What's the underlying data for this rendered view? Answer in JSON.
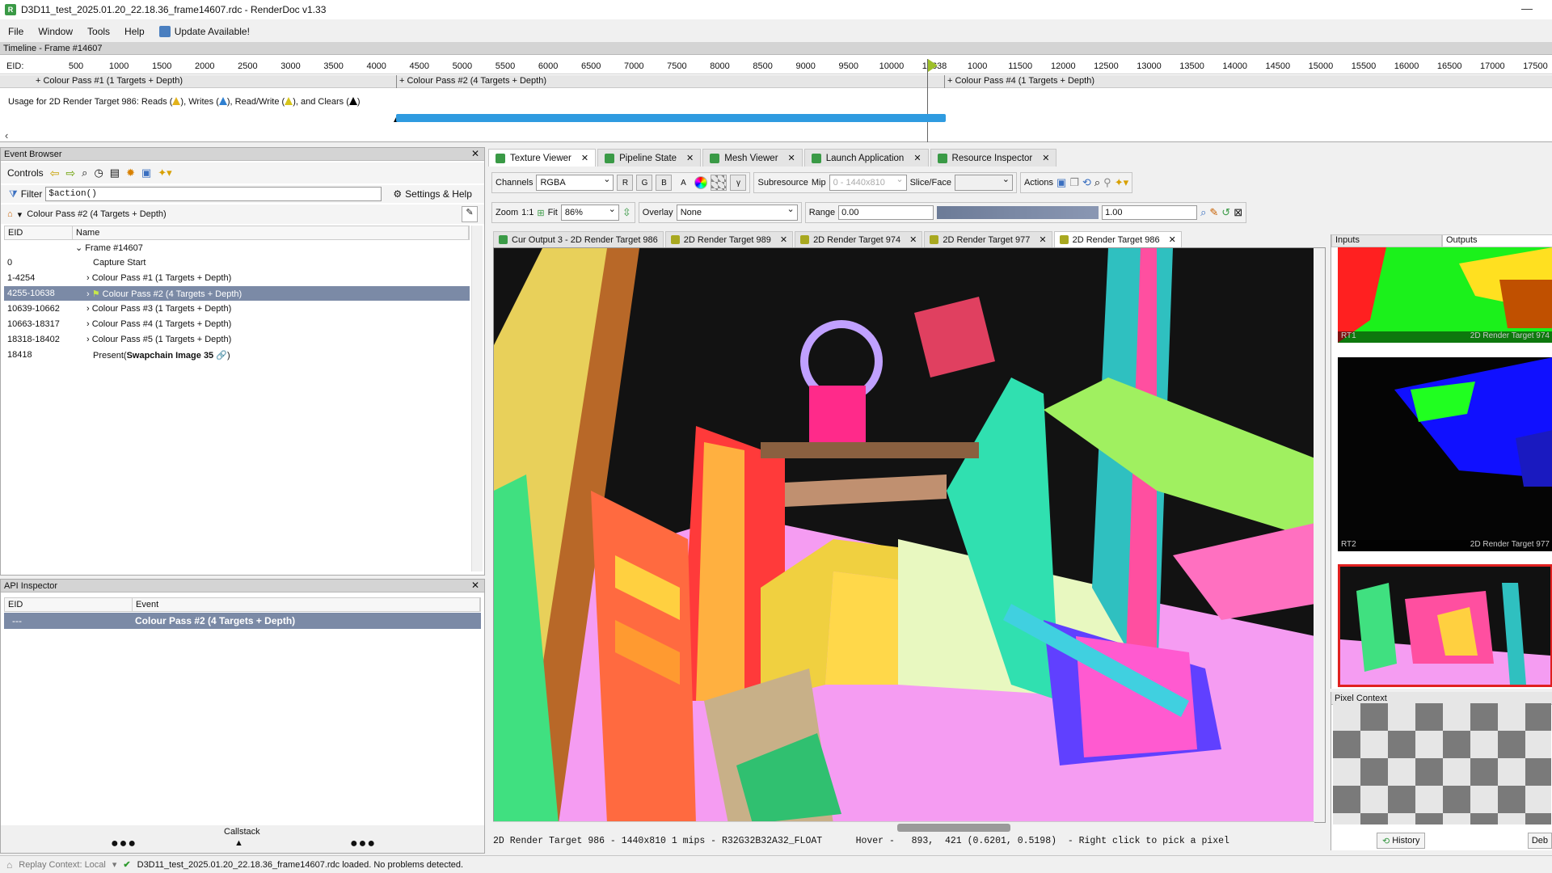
{
  "window": {
    "title": "D3D11_test_2025.01.20_22.18.36_frame14607.rdc - RenderDoc v1.33"
  },
  "menu": {
    "file": "File",
    "window": "Window",
    "tools": "Tools",
    "help": "Help",
    "update": "Update Available!"
  },
  "timeline": {
    "title": "Timeline - Frame #14607",
    "eid_label": "EID:",
    "ticks": [
      "500",
      "1000",
      "1500",
      "2000",
      "2500",
      "3000",
      "3500",
      "4000",
      "4500",
      "5000",
      "5500",
      "6000",
      "6500",
      "7000",
      "7500",
      "8000",
      "8500",
      "9000",
      "9500",
      "10000",
      "10638",
      "1000",
      "11500",
      "12000",
      "12500",
      "13000",
      "13500",
      "14000",
      "14500",
      "15000",
      "15500",
      "16000",
      "16500",
      "17000",
      "17500"
    ],
    "passes": [
      "+ Colour Pass #1 (1 Targets + Depth)",
      "+ Colour Pass #2 (4 Targets + Depth)",
      "+ Colour Pass #4 (1 Targets + Depth)"
    ],
    "usage_prefix": "Usage for 2D Render Target 986: Reads (",
    "usage_writes": "), Writes (",
    "usage_rw": "), Read/Write (",
    "usage_clears": "), and Clears (",
    "usage_end": ")"
  },
  "event_browser": {
    "title": "Event Browser",
    "controls_label": "Controls",
    "filter_label": "Filter",
    "filter_value": "$action()",
    "settings_label": "Settings & Help",
    "breadcrumb": "Colour Pass #2 (4 Targets + Depth)",
    "col_eid": "EID",
    "col_name": "Name",
    "rows": [
      {
        "eid": "",
        "name": "Frame #14607"
      },
      {
        "eid": "0",
        "name": "Capture Start"
      },
      {
        "eid": "1-4254",
        "name": "Colour Pass #1 (1 Targets + Depth)"
      },
      {
        "eid": "4255-10638",
        "name": "Colour Pass #2 (4 Targets + Depth)"
      },
      {
        "eid": "10639-10662",
        "name": "Colour Pass #3 (1 Targets + Depth)"
      },
      {
        "eid": "10663-18317",
        "name": "Colour Pass #4 (1 Targets + Depth)"
      },
      {
        "eid": "18318-18402",
        "name": "Colour Pass #5 (1 Targets + Depth)"
      },
      {
        "eid": "18418",
        "name": "Present(",
        "bold": "Swapchain Image 35",
        "tail": ")"
      }
    ]
  },
  "api_inspector": {
    "title": "API Inspector",
    "col_eid": "EID",
    "col_event": "Event",
    "row_eid": "---",
    "row_event": "Colour Pass #2 (4 Targets + Depth)",
    "callstack": "Callstack"
  },
  "main_tabs": [
    "Texture Viewer",
    "Pipeline State",
    "Mesh Viewer",
    "Launch Application",
    "Resource Inspector"
  ],
  "texture_viewer": {
    "channels_label": "Channels",
    "channels_value": "RGBA",
    "ch_r": "R",
    "ch_g": "G",
    "ch_b": "B",
    "ch_a": "A",
    "gamma": "γ",
    "subresource_label": "Subresource",
    "mip_label": "Mip",
    "mip_value": "0 - 1440x810",
    "slice_label": "Slice/Face",
    "actions_label": "Actions",
    "zoom_label": "Zoom",
    "zoom_1to1": "1:1",
    "fit_label": "Fit",
    "zoom_value": "86%",
    "overlay_label": "Overlay",
    "overlay_value": "None",
    "range_label": "Range",
    "range_min": "0.00",
    "range_max": "1.00",
    "subtabs": [
      "Cur Output 3 - 2D Render Target 986",
      "2D Render Target 989",
      "2D Render Target 974",
      "2D Render Target 977",
      "2D Render Target 986"
    ],
    "status": "2D Render Target 986 - 1440x810 1 mips - R32G32B32A32_FLOAT      Hover -   893,  421 (0.6201, 0.5198)  - Right click to pick a pixel"
  },
  "right_pane": {
    "inputs_tab": "Inputs",
    "outputs_tab": "Outputs",
    "thumbs": [
      {
        "slot": "RT1",
        "name": "2D Render Target 974"
      },
      {
        "slot": "RT2",
        "name": "2D Render Target 977"
      }
    ],
    "pixel_context": "Pixel Context",
    "history": "History",
    "debug": "Deb"
  },
  "status_bar": {
    "replay": "Replay Context: Local",
    "message": "D3D11_test_2025.01.20_22.18.36_frame14607.rdc loaded. No problems detected."
  },
  "colors": {
    "accent_green": "#3a9a46",
    "selection": "#7b8aa6",
    "usage_bar": "#2f9be0"
  }
}
